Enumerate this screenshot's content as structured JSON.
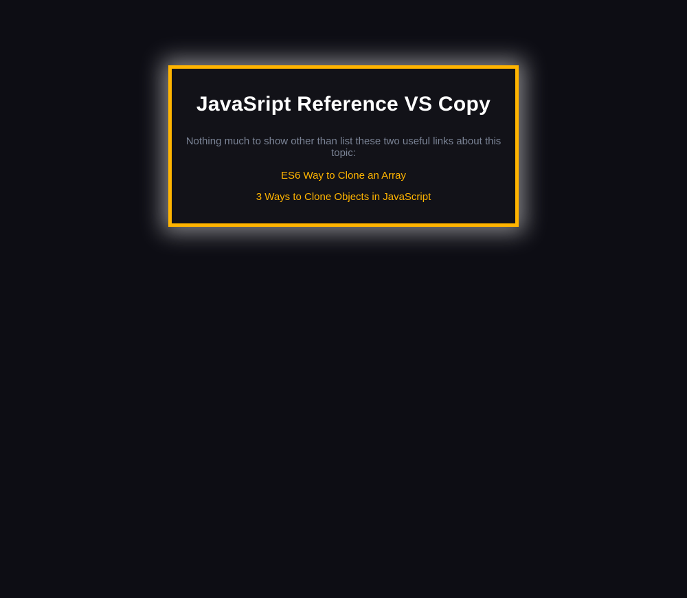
{
  "card": {
    "title": "JavaSript Reference VS Copy",
    "subtitle": "Nothing much to show other than list these two useful links about this topic:",
    "links": [
      "ES6 Way to Clone an Array",
      "3 Ways to Clone Objects in JavaScript"
    ]
  }
}
